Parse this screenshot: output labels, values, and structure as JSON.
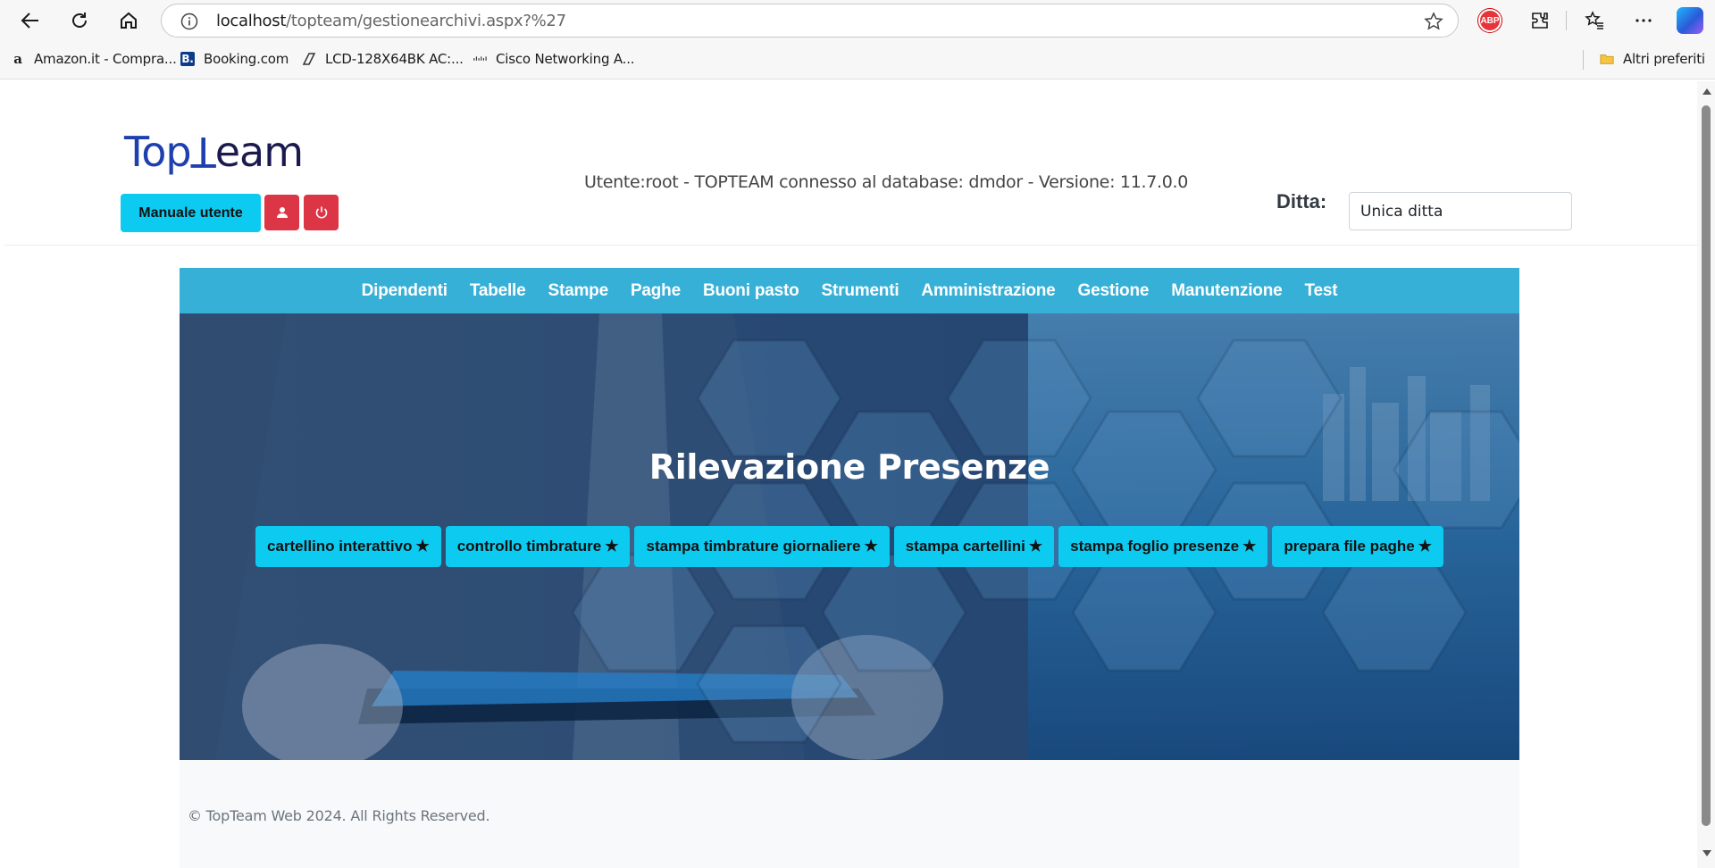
{
  "browser": {
    "url_host": "localhost",
    "url_path": "/topteam/gestionearchivi.aspx?%27",
    "extension_badge": "ABP",
    "bookmarks": [
      {
        "label": "Amazon.it - Compra...",
        "icon": "amazon-icon"
      },
      {
        "label": "Booking.com",
        "icon": "booking-icon"
      },
      {
        "label": "LCD-128X64BK AC:...",
        "icon": "lcd-icon"
      },
      {
        "label": "Cisco Networking A...",
        "icon": "cisco-icon"
      }
    ],
    "other_favorites": "Altri preferiti"
  },
  "header": {
    "logo_text": "TopTeam",
    "manual_button": "Manuale utente",
    "status_text": "Utente:root - TOPTEAM connesso al database: dmdor - Versione: 11.7.0.0",
    "ditta_label": "Ditta:",
    "ditta_value": "Unica ditta"
  },
  "menu": {
    "items": [
      "Dipendenti",
      "Tabelle",
      "Stampe",
      "Paghe",
      "Buoni pasto",
      "Strumenti",
      "Amministrazione",
      "Gestione",
      "Manutenzione",
      "Test"
    ]
  },
  "hero": {
    "title": "Rilevazione Presenze",
    "buttons": [
      {
        "label": "cartellino interattivo",
        "star": "★"
      },
      {
        "label": "controllo timbrature",
        "star": "★"
      },
      {
        "label": "stampa timbrature giornaliere",
        "star": "★"
      },
      {
        "label": "stampa cartellini",
        "star": "★"
      },
      {
        "label": "stampa foglio presenze",
        "star": "★"
      },
      {
        "label": "prepara file paghe",
        "star": "★"
      }
    ]
  },
  "footer": {
    "copyright": "© TopTeam Web 2024. All Rights Reserved."
  },
  "colors": {
    "accent_cyan": "#0dcaf0",
    "menu_blue": "#37b0d8",
    "danger_red": "#dc3545"
  }
}
